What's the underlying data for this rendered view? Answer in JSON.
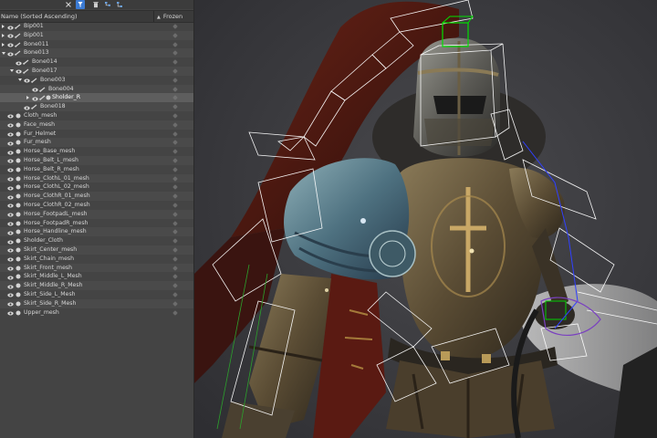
{
  "explorer": {
    "column_name": "Name (Sorted Ascending)",
    "column_frozen": "Frozen",
    "rows": [
      {
        "label": "Bip001",
        "indent": 0,
        "expand": "collapsed",
        "type": "bone"
      },
      {
        "label": "Bip001",
        "indent": 0,
        "expand": "collapsed",
        "type": "bone"
      },
      {
        "label": "Bone011",
        "indent": 0,
        "expand": "collapsed",
        "type": "bone"
      },
      {
        "label": "Bone013",
        "indent": 0,
        "expand": "expanded",
        "type": "bone"
      },
      {
        "label": "Bone014",
        "indent": 1,
        "expand": "none",
        "type": "bone"
      },
      {
        "label": "Bone017",
        "indent": 1,
        "expand": "expanded",
        "type": "bone"
      },
      {
        "label": "Bone003",
        "indent": 2,
        "expand": "expanded",
        "type": "bone"
      },
      {
        "label": "Bone004",
        "indent": 3,
        "expand": "none",
        "type": "bone"
      },
      {
        "label": "Sholder_R",
        "indent": 3,
        "expand": "collapsed",
        "type": "bone",
        "selected": true
      },
      {
        "label": "Bone018",
        "indent": 2,
        "expand": "none",
        "type": "bone"
      },
      {
        "label": "Cloth_mesh",
        "indent": 0,
        "expand": "none",
        "type": "mesh"
      },
      {
        "label": "Face_mesh",
        "indent": 0,
        "expand": "none",
        "type": "mesh"
      },
      {
        "label": "Fur_Helmet",
        "indent": 0,
        "expand": "none",
        "type": "mesh"
      },
      {
        "label": "Fur_mesh",
        "indent": 0,
        "expand": "none",
        "type": "mesh"
      },
      {
        "label": "Horse_Base_mesh",
        "indent": 0,
        "expand": "none",
        "type": "mesh"
      },
      {
        "label": "Horse_Belt_L_mesh",
        "indent": 0,
        "expand": "none",
        "type": "mesh"
      },
      {
        "label": "Horse_Belt_R_mesh",
        "indent": 0,
        "expand": "none",
        "type": "mesh"
      },
      {
        "label": "Horse_ClothL_01_mesh",
        "indent": 0,
        "expand": "none",
        "type": "mesh"
      },
      {
        "label": "Horse_ClothL_02_mesh",
        "indent": 0,
        "expand": "none",
        "type": "mesh"
      },
      {
        "label": "Horse_ClothR_01_mesh",
        "indent": 0,
        "expand": "none",
        "type": "mesh"
      },
      {
        "label": "Horse_ClothR_02_mesh",
        "indent": 0,
        "expand": "none",
        "type": "mesh"
      },
      {
        "label": "Horse_FootpadL_mesh",
        "indent": 0,
        "expand": "none",
        "type": "mesh"
      },
      {
        "label": "Horse_FootpadR_mesh",
        "indent": 0,
        "expand": "none",
        "type": "mesh"
      },
      {
        "label": "Horse_Handline_mesh",
        "indent": 0,
        "expand": "none",
        "type": "mesh"
      },
      {
        "label": "Sholder_Cloth",
        "indent": 0,
        "expand": "none",
        "type": "mesh"
      },
      {
        "label": "Skirt_Center_mesh",
        "indent": 0,
        "expand": "none",
        "type": "mesh"
      },
      {
        "label": "Skirt_Chain_mesh",
        "indent": 0,
        "expand": "none",
        "type": "mesh"
      },
      {
        "label": "Skirt_Front_mesh",
        "indent": 0,
        "expand": "none",
        "type": "mesh"
      },
      {
        "label": "Skirt_Middle_L_Mesh",
        "indent": 0,
        "expand": "none",
        "type": "mesh"
      },
      {
        "label": "Skirt_Middle_R_Mesh",
        "indent": 0,
        "expand": "none",
        "type": "mesh"
      },
      {
        "label": "Skirt_Side_L_Mesh",
        "indent": 0,
        "expand": "none",
        "type": "mesh"
      },
      {
        "label": "Skirt_Side_R_Mesh",
        "indent": 0,
        "expand": "none",
        "type": "mesh"
      },
      {
        "label": "Upper_mesh",
        "indent": 0,
        "expand": "none",
        "type": "mesh"
      }
    ]
  },
  "toolbar_icons": [
    "close-icon",
    "select-filter-icon",
    "delete-icon",
    "hierarchy-icon",
    "link-icon"
  ],
  "colors": {
    "panel_bg": "#444444",
    "selected_row": "#5e5e5e",
    "bone_wire": "#ffffff",
    "helper_green": "#00e000",
    "helper_blue": "#3040ff"
  }
}
